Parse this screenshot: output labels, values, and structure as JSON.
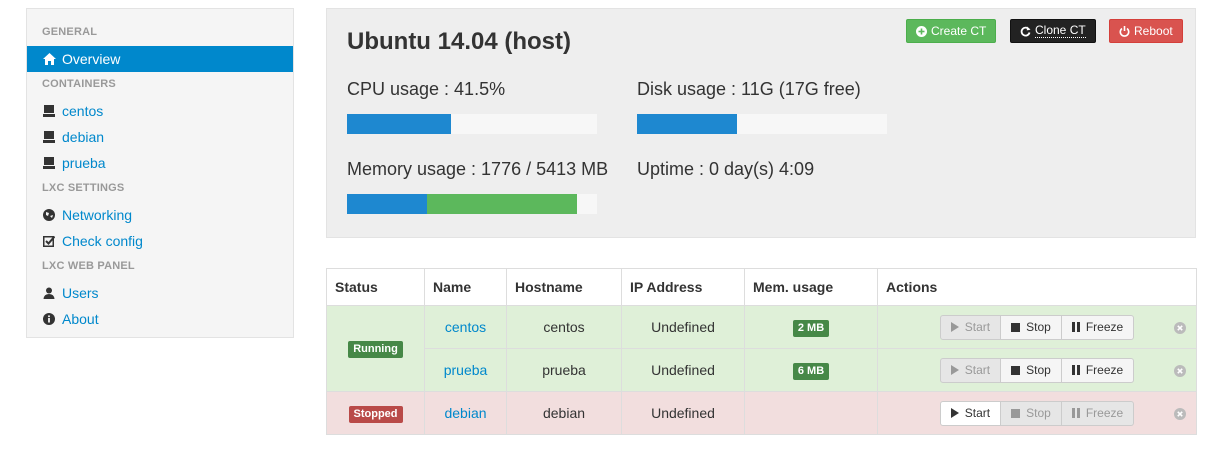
{
  "sidebar": {
    "sections": [
      {
        "header": "GENERAL",
        "items": [
          {
            "label": "Overview",
            "icon": "home-icon",
            "active": true
          }
        ]
      },
      {
        "header": "CONTAINERS",
        "items": [
          {
            "label": "centos",
            "icon": "server-icon"
          },
          {
            "label": "debian",
            "icon": "server-icon"
          },
          {
            "label": "prueba",
            "icon": "server-icon"
          }
        ]
      },
      {
        "header": "LXC SETTINGS",
        "items": [
          {
            "label": "Networking",
            "icon": "globe-icon"
          },
          {
            "label": "Check config",
            "icon": "check-icon"
          }
        ]
      },
      {
        "header": "LXC WEB PANEL",
        "items": [
          {
            "label": "Users",
            "icon": "user-icon"
          },
          {
            "label": "About",
            "icon": "info-icon"
          }
        ]
      }
    ]
  },
  "host": {
    "title": "Ubuntu 14.04 (host)",
    "cpu_label": "CPU usage : 41.5%",
    "cpu_percent": 41.5,
    "disk_label": "Disk usage : 11G (17G free)",
    "disk_fraction": 0.4,
    "memory_label": "Memory usage : 1776 / 5413 MB",
    "memory_used_fraction": 0.32,
    "memory_cached_fraction": 0.6,
    "uptime_label": "Uptime : 0 day(s) 4:09",
    "buttons": {
      "create": "Create CT",
      "clone": "Clone CT",
      "reboot": "Reboot"
    }
  },
  "table": {
    "headers": [
      "Status",
      "Name",
      "Hostname",
      "IP Address",
      "Mem. usage",
      "Actions"
    ],
    "status_running": "Running",
    "status_stopped": "Stopped",
    "rows": [
      {
        "name": "centos",
        "hostname": "centos",
        "ip": "Undefined",
        "mem": "2 MB"
      },
      {
        "name": "prueba",
        "hostname": "prueba",
        "ip": "Undefined",
        "mem": "6 MB"
      },
      {
        "name": "debian",
        "hostname": "debian",
        "ip": "Undefined",
        "mem": ""
      }
    ],
    "actions": {
      "start": "Start",
      "stop": "Stop",
      "freeze": "Freeze"
    }
  },
  "colors": {
    "primary": "#0088cc",
    "bar_blue": "#1e88d0",
    "bar_green": "#5cb85c",
    "create_btn": "#5cb85c",
    "clone_btn": "#222222",
    "reboot_btn": "#d9534f",
    "running_row": "#dff0d8",
    "stopped_row": "#f2dede"
  }
}
